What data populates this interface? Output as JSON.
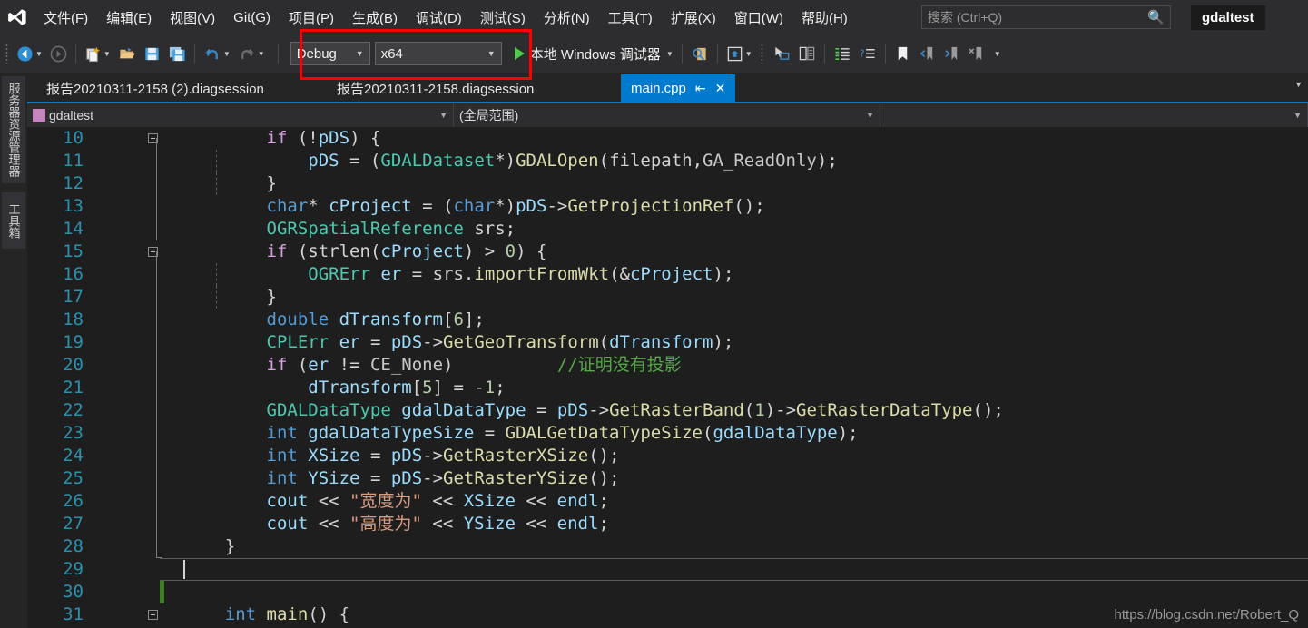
{
  "window": {
    "project_badge": "gdaltest"
  },
  "menubar": {
    "logo_icon": "visual-studio-logo",
    "items": [
      {
        "label": "文件(F)"
      },
      {
        "label": "编辑(E)"
      },
      {
        "label": "视图(V)"
      },
      {
        "label": "Git(G)"
      },
      {
        "label": "项目(P)"
      },
      {
        "label": "生成(B)"
      },
      {
        "label": "调试(D)"
      },
      {
        "label": "测试(S)"
      },
      {
        "label": "分析(N)"
      },
      {
        "label": "工具(T)"
      },
      {
        "label": "扩展(X)"
      },
      {
        "label": "窗口(W)"
      },
      {
        "label": "帮助(H)"
      }
    ],
    "search": {
      "placeholder": "搜索 (Ctrl+Q)",
      "icon": "search-icon"
    }
  },
  "toolbar": {
    "back_icon": "navigate-back-icon",
    "forward_icon": "navigate-forward-icon",
    "new_item_icon": "new-item-icon",
    "open_icon": "open-folder-icon",
    "save_icon": "save-icon",
    "save_all_icon": "save-all-icon",
    "undo_icon": "undo-icon",
    "redo_icon": "redo-icon",
    "config_value": "Debug",
    "platform_value": "x64",
    "run_label": "本地 Windows 调试器",
    "run_icon": "play-triangle-icon",
    "find_icon": "find-in-files-icon",
    "window_icon": "window-layout-icon",
    "cursor_icon": "pointer-select-icon",
    "compare_icon": "compare-files-icon",
    "indent_icon": "indent-icon",
    "help_indent_icon": "quick-actions-icon",
    "bookmark_icon": "bookmark-icon",
    "prev_bookmark_icon": "previous-bookmark-icon",
    "next_bookmark_icon": "next-bookmark-icon",
    "clear_bookmark_icon": "clear-bookmarks-icon",
    "overflow_icon": "toolbar-overflow-icon",
    "highlight_color": "#ff0000"
  },
  "left_dock": {
    "tabs": [
      {
        "label": "服务器资源管理器"
      },
      {
        "label": "工具箱"
      }
    ]
  },
  "tabs": {
    "items": [
      {
        "label": "报告20210311-2158 (2).diagsession",
        "active": false
      },
      {
        "label": "报告20210311-2158.diagsession",
        "active": false
      },
      {
        "label": "main.cpp",
        "active": true,
        "pin_icon": "pin-icon",
        "close_icon": "close-icon"
      }
    ],
    "overflow_icon": "chevron-down-icon",
    "active_color": "#007acc"
  },
  "navbar": {
    "project": "gdaltest",
    "project_icon": "cpp-project-icon",
    "scope": "(全局范围)",
    "member": "",
    "dropdown_icon": "chevron-down-icon"
  },
  "editor": {
    "watermark": "https://blog.csdn.net/Robert_Q",
    "cursor_line": 29,
    "lines": [
      {
        "num": "10",
        "fold": "minus",
        "indent_guides": [],
        "tokens": [
          {
            "t": "        ",
            "c": "p"
          },
          {
            "t": "if",
            "c": "kc"
          },
          {
            "t": " (!",
            "c": "p"
          },
          {
            "t": "pDS",
            "c": "v"
          },
          {
            "t": ") {",
            "c": "p"
          }
        ]
      },
      {
        "num": "11",
        "fold": "",
        "indent_guides": [
          208
        ],
        "tokens": [
          {
            "t": "            ",
            "c": "p"
          },
          {
            "t": "pDS",
            "c": "v"
          },
          {
            "t": " = (",
            "c": "p"
          },
          {
            "t": "GDALDataset",
            "c": "t"
          },
          {
            "t": "*)",
            "c": "p"
          },
          {
            "t": "GDALOpen",
            "c": "f"
          },
          {
            "t": "(",
            "c": "p"
          },
          {
            "t": "filepath",
            "c": "p"
          },
          {
            "t": ",",
            "c": "p"
          },
          {
            "t": "GA_ReadOnly",
            "c": "m"
          },
          {
            "t": ");",
            "c": "p"
          }
        ]
      },
      {
        "num": "12",
        "fold": "",
        "indent_guides": [
          208
        ],
        "tokens": [
          {
            "t": "        }",
            "c": "p"
          }
        ]
      },
      {
        "num": "13",
        "fold": "",
        "indent_guides": [],
        "tokens": [
          {
            "t": "        ",
            "c": "p"
          },
          {
            "t": "char",
            "c": "k"
          },
          {
            "t": "* ",
            "c": "p"
          },
          {
            "t": "cProject",
            "c": "v"
          },
          {
            "t": " = (",
            "c": "p"
          },
          {
            "t": "char",
            "c": "k"
          },
          {
            "t": "*)",
            "c": "p"
          },
          {
            "t": "pDS",
            "c": "v"
          },
          {
            "t": "->",
            "c": "p"
          },
          {
            "t": "GetProjectionRef",
            "c": "f"
          },
          {
            "t": "();",
            "c": "p"
          }
        ]
      },
      {
        "num": "14",
        "fold": "",
        "indent_guides": [],
        "tokens": [
          {
            "t": "        ",
            "c": "p"
          },
          {
            "t": "OGRSpatialReference",
            "c": "t"
          },
          {
            "t": " ",
            "c": "p"
          },
          {
            "t": "srs",
            "c": "p"
          },
          {
            "t": ";",
            "c": "p"
          }
        ]
      },
      {
        "num": "15",
        "fold": "minus",
        "indent_guides": [],
        "tokens": [
          {
            "t": "        ",
            "c": "p"
          },
          {
            "t": "if",
            "c": "kc"
          },
          {
            "t": " (",
            "c": "p"
          },
          {
            "t": "strlen",
            "c": "p"
          },
          {
            "t": "(",
            "c": "p"
          },
          {
            "t": "cProject",
            "c": "v"
          },
          {
            "t": ") > ",
            "c": "p"
          },
          {
            "t": "0",
            "c": "n"
          },
          {
            "t": ") {",
            "c": "p"
          }
        ]
      },
      {
        "num": "16",
        "fold": "",
        "indent_guides": [
          208
        ],
        "tokens": [
          {
            "t": "            ",
            "c": "p"
          },
          {
            "t": "OGRErr",
            "c": "t"
          },
          {
            "t": " ",
            "c": "p"
          },
          {
            "t": "er",
            "c": "v"
          },
          {
            "t": " = ",
            "c": "p"
          },
          {
            "t": "srs",
            "c": "p"
          },
          {
            "t": ".",
            "c": "p"
          },
          {
            "t": "importFromWkt",
            "c": "f"
          },
          {
            "t": "(&",
            "c": "p"
          },
          {
            "t": "cProject",
            "c": "v"
          },
          {
            "t": ");",
            "c": "p"
          }
        ]
      },
      {
        "num": "17",
        "fold": "",
        "indent_guides": [
          208
        ],
        "tokens": [
          {
            "t": "        }",
            "c": "p"
          }
        ]
      },
      {
        "num": "18",
        "fold": "",
        "indent_guides": [],
        "tokens": [
          {
            "t": "        ",
            "c": "p"
          },
          {
            "t": "double",
            "c": "k"
          },
          {
            "t": " ",
            "c": "p"
          },
          {
            "t": "dTransform",
            "c": "v"
          },
          {
            "t": "[",
            "c": "p"
          },
          {
            "t": "6",
            "c": "n"
          },
          {
            "t": "];",
            "c": "p"
          }
        ]
      },
      {
        "num": "19",
        "fold": "",
        "indent_guides": [],
        "tokens": [
          {
            "t": "        ",
            "c": "p"
          },
          {
            "t": "CPLErr",
            "c": "t"
          },
          {
            "t": " ",
            "c": "p"
          },
          {
            "t": "er",
            "c": "v"
          },
          {
            "t": " = ",
            "c": "p"
          },
          {
            "t": "pDS",
            "c": "v"
          },
          {
            "t": "->",
            "c": "p"
          },
          {
            "t": "GetGeoTransform",
            "c": "f"
          },
          {
            "t": "(",
            "c": "p"
          },
          {
            "t": "dTransform",
            "c": "v"
          },
          {
            "t": ");",
            "c": "p"
          }
        ]
      },
      {
        "num": "20",
        "fold": "",
        "indent_guides": [],
        "tokens": [
          {
            "t": "        ",
            "c": "p"
          },
          {
            "t": "if",
            "c": "kc"
          },
          {
            "t": " (",
            "c": "p"
          },
          {
            "t": "er",
            "c": "v"
          },
          {
            "t": " != ",
            "c": "p"
          },
          {
            "t": "CE_None",
            "c": "m"
          },
          {
            "t": ")          ",
            "c": "p"
          },
          {
            "t": "//证明没有投影",
            "c": "cm"
          }
        ]
      },
      {
        "num": "21",
        "fold": "",
        "indent_guides": [],
        "tokens": [
          {
            "t": "            ",
            "c": "p"
          },
          {
            "t": "dTransform",
            "c": "v"
          },
          {
            "t": "[",
            "c": "p"
          },
          {
            "t": "5",
            "c": "n"
          },
          {
            "t": "] = -",
            "c": "p"
          },
          {
            "t": "1",
            "c": "n"
          },
          {
            "t": ";",
            "c": "p"
          }
        ]
      },
      {
        "num": "22",
        "fold": "",
        "indent_guides": [],
        "tokens": [
          {
            "t": "        ",
            "c": "p"
          },
          {
            "t": "GDALDataType",
            "c": "t"
          },
          {
            "t": " ",
            "c": "p"
          },
          {
            "t": "gdalDataType",
            "c": "v"
          },
          {
            "t": " = ",
            "c": "p"
          },
          {
            "t": "pDS",
            "c": "v"
          },
          {
            "t": "->",
            "c": "p"
          },
          {
            "t": "GetRasterBand",
            "c": "f"
          },
          {
            "t": "(",
            "c": "p"
          },
          {
            "t": "1",
            "c": "n"
          },
          {
            "t": ")->",
            "c": "p"
          },
          {
            "t": "GetRasterDataType",
            "c": "f"
          },
          {
            "t": "();",
            "c": "p"
          }
        ]
      },
      {
        "num": "23",
        "fold": "",
        "indent_guides": [],
        "tokens": [
          {
            "t": "        ",
            "c": "p"
          },
          {
            "t": "int",
            "c": "k"
          },
          {
            "t": " ",
            "c": "p"
          },
          {
            "t": "gdalDataTypeSize",
            "c": "v"
          },
          {
            "t": " = ",
            "c": "p"
          },
          {
            "t": "GDALGetDataTypeSize",
            "c": "f"
          },
          {
            "t": "(",
            "c": "p"
          },
          {
            "t": "gdalDataType",
            "c": "v"
          },
          {
            "t": ");",
            "c": "p"
          }
        ]
      },
      {
        "num": "24",
        "fold": "",
        "indent_guides": [],
        "tokens": [
          {
            "t": "        ",
            "c": "p"
          },
          {
            "t": "int",
            "c": "k"
          },
          {
            "t": " ",
            "c": "p"
          },
          {
            "t": "XSize",
            "c": "v"
          },
          {
            "t": " = ",
            "c": "p"
          },
          {
            "t": "pDS",
            "c": "v"
          },
          {
            "t": "->",
            "c": "p"
          },
          {
            "t": "GetRasterXSize",
            "c": "f"
          },
          {
            "t": "();",
            "c": "p"
          }
        ]
      },
      {
        "num": "25",
        "fold": "",
        "indent_guides": [],
        "tokens": [
          {
            "t": "        ",
            "c": "p"
          },
          {
            "t": "int",
            "c": "k"
          },
          {
            "t": " ",
            "c": "p"
          },
          {
            "t": "YSize",
            "c": "v"
          },
          {
            "t": " = ",
            "c": "p"
          },
          {
            "t": "pDS",
            "c": "v"
          },
          {
            "t": "->",
            "c": "p"
          },
          {
            "t": "GetRasterYSize",
            "c": "f"
          },
          {
            "t": "();",
            "c": "p"
          }
        ]
      },
      {
        "num": "26",
        "fold": "",
        "indent_guides": [],
        "tokens": [
          {
            "t": "        ",
            "c": "p"
          },
          {
            "t": "cout",
            "c": "v"
          },
          {
            "t": " << ",
            "c": "p"
          },
          {
            "t": "\"宽度为\"",
            "c": "s"
          },
          {
            "t": " << ",
            "c": "p"
          },
          {
            "t": "XSize",
            "c": "v"
          },
          {
            "t": " << ",
            "c": "p"
          },
          {
            "t": "endl",
            "c": "v"
          },
          {
            "t": ";",
            "c": "p"
          }
        ]
      },
      {
        "num": "27",
        "fold": "",
        "indent_guides": [],
        "tokens": [
          {
            "t": "        ",
            "c": "p"
          },
          {
            "t": "cout",
            "c": "v"
          },
          {
            "t": " << ",
            "c": "p"
          },
          {
            "t": "\"高度为\"",
            "c": "s"
          },
          {
            "t": " << ",
            "c": "p"
          },
          {
            "t": "YSize",
            "c": "v"
          },
          {
            "t": " << ",
            "c": "p"
          },
          {
            "t": "endl",
            "c": "v"
          },
          {
            "t": ";",
            "c": "p"
          }
        ]
      },
      {
        "num": "28",
        "fold": "",
        "indent_guides": [],
        "tokens": [
          {
            "t": "    }",
            "c": "p"
          }
        ]
      },
      {
        "num": "29",
        "fold": "",
        "indent_guides": [],
        "tokens": []
      },
      {
        "num": "30",
        "fold": "",
        "indent_guides": [],
        "tokens": []
      },
      {
        "num": "31",
        "fold": "minus",
        "indent_guides": [],
        "tokens": [
          {
            "t": "    ",
            "c": "p"
          },
          {
            "t": "int",
            "c": "k"
          },
          {
            "t": " ",
            "c": "p"
          },
          {
            "t": "main",
            "c": "f"
          },
          {
            "t": "() {",
            "c": "p"
          }
        ]
      }
    ]
  }
}
